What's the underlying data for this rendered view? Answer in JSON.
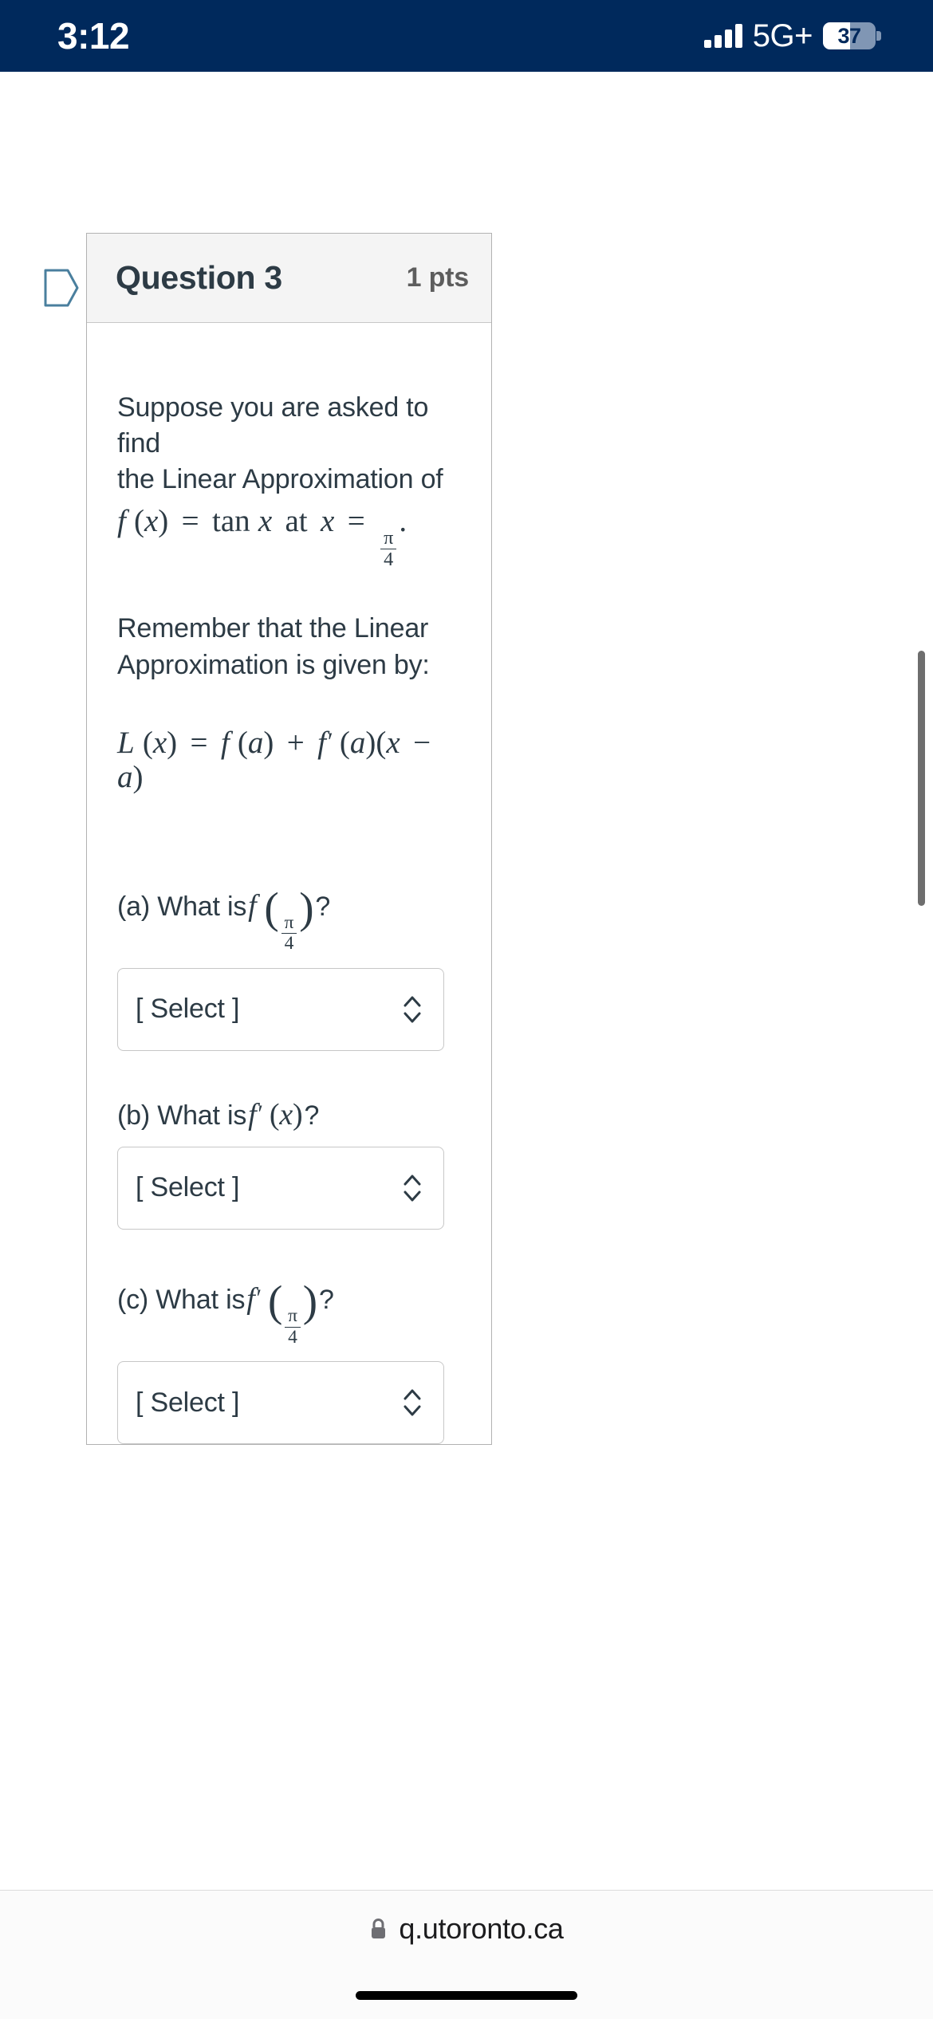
{
  "status_bar": {
    "time": "3:12",
    "network": "5G+",
    "battery_percent": "37",
    "background_color": "#00295c"
  },
  "question": {
    "title": "Question 3",
    "points": "1 pts",
    "flag_icon": "flag-outline-icon",
    "header_bg": "#f4f4f4",
    "text_color": "#2d3b45",
    "paragraph_1_line_1": "Suppose you are asked to find",
    "paragraph_1_line_2": "the Linear Approximation of",
    "formula_1": {
      "f": "f",
      "open": "(",
      "var": "x",
      "close": ")",
      "equals": "=",
      "tan": "tan",
      "tan_arg": "x",
      "at": "at",
      "at_var": "x",
      "at_equals": "=",
      "frac_num": "π",
      "frac_den": "4",
      "period": "."
    },
    "paragraph_2_line_1": "Remember that the Linear",
    "paragraph_2_line_2": "Approximation is given by:",
    "formula_2": {
      "L": "L",
      "p1": "(",
      "x1": "x",
      "p2": ")",
      "eq": "=",
      "f1": "f",
      "p3": "(",
      "a1": "a",
      "p4": ")",
      "plus": "+",
      "fprime": "f",
      "prime": "′",
      "p5": "(",
      "a2": "a",
      "p6": ")",
      "p7": "(",
      "x2": "x",
      "minus": "−",
      "a3": "a",
      "p8": ")"
    },
    "sub_questions": [
      {
        "id": "a",
        "prefix": "(a) What is",
        "math_fn": "f",
        "math_prime": "",
        "math_open": "(",
        "math_num": "π",
        "math_den": "4",
        "math_close": ")",
        "suffix": "?",
        "select_value": "[ Select ]",
        "select_icon": "chevron-up-down-icon"
      },
      {
        "id": "b",
        "prefix": "(b) What is",
        "math_fn": "f",
        "math_prime": "′",
        "math_open": "(",
        "math_plain": "x",
        "math_close": ")",
        "suffix": "?",
        "select_value": "[ Select ]",
        "select_icon": "chevron-up-down-icon"
      },
      {
        "id": "c",
        "prefix": "(c) What is",
        "math_fn": "f",
        "math_prime": "′",
        "math_open": "(",
        "math_num": "π",
        "math_den": "4",
        "math_close": ")",
        "suffix": "?",
        "select_value": "[ Select ]",
        "select_icon": "chevron-up-down-icon"
      }
    ]
  },
  "browser_bar": {
    "url": "q.utoronto.ca",
    "lock_icon": "lock-icon"
  }
}
